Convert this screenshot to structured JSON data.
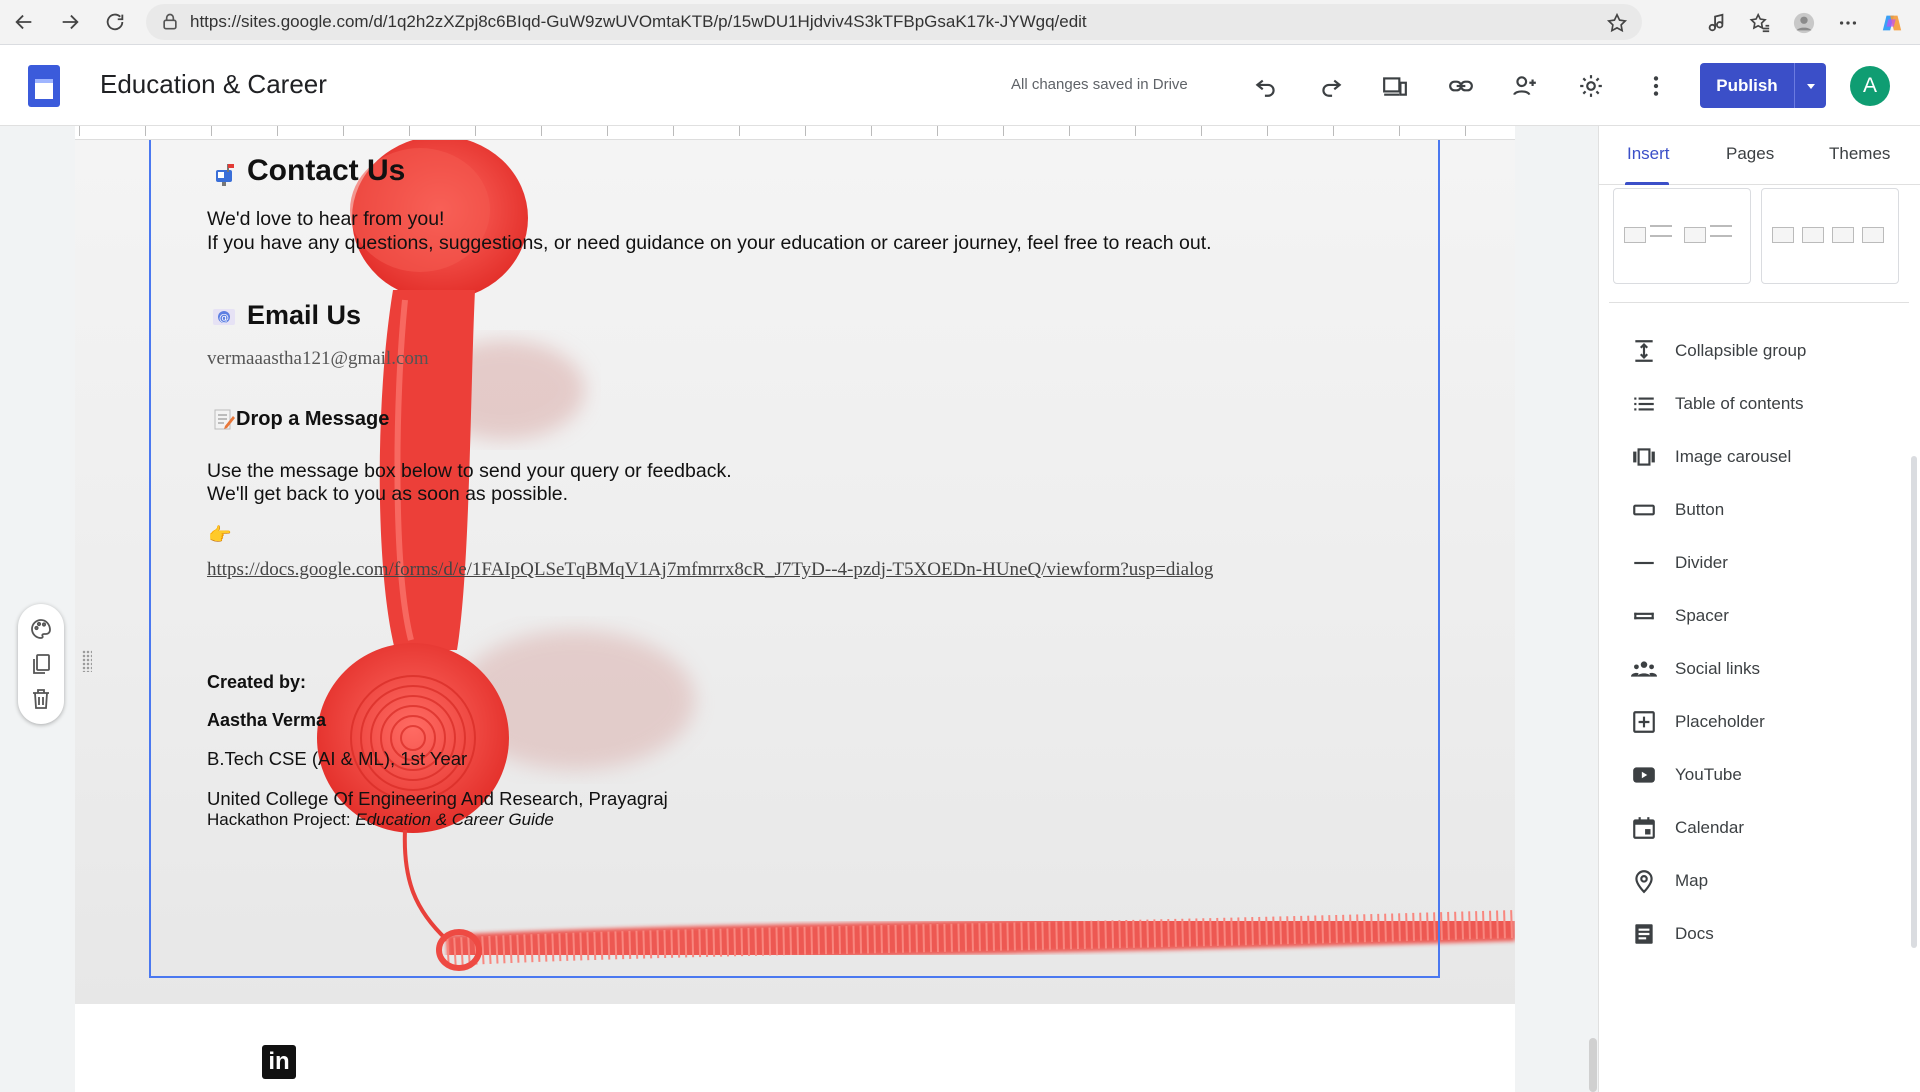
{
  "browser": {
    "url": "https://sites.google.com/d/1q2h2zXZpj8c6BIqd-GuW9zwUVOmtaKTB/p/15wDU1Hjdviv4S3kTFBpGsaK17k-JYWgq/edit"
  },
  "toolbar": {
    "site_title": "Education & Career",
    "saved_status": "All changes saved in Drive",
    "publish_label": "Publish",
    "avatar_letter": "A"
  },
  "content": {
    "contact_heading": "Contact Us",
    "contact_line1": "We'd love to hear from you!",
    "contact_line2": "If you have any questions, suggestions, or need guidance on your education or career journey, feel free to reach out.",
    "email_heading": "Email Us",
    "email_address": "vermaaastha121@gmail.com",
    "message_heading": "Drop a Message",
    "message_line1": "Use the message box below to send your query or feedback.",
    "message_line2": "We'll get back to you as soon as possible.",
    "pointer_emoji": "👉",
    "form_link": "https://docs.google.com/forms/d/e/1FAIpQLSeTqBMqV1Aj7mfmrrx8cR_J7TyD--4-pzdj-T5XOEDn-HUneQ/viewform?usp=dialog",
    "created_by_label": "Created by:",
    "author_name": "Aastha Verma",
    "author_course": "B.Tech CSE (AI & ML), 1st Year",
    "author_college": "United College Of Engineering And Research, Prayagraj",
    "project_prefix": "Hackathon Project: ",
    "project_name": "Education & Career Guide"
  },
  "footer": {
    "linkedin_glyph": "in"
  },
  "panel": {
    "tabs": [
      "Insert",
      "Pages",
      "Themes"
    ],
    "active_tab": "Insert",
    "items": [
      {
        "label": "Collapsible group",
        "icon": "collapsible-icon"
      },
      {
        "label": "Table of contents",
        "icon": "list-icon"
      },
      {
        "label": "Image carousel",
        "icon": "carousel-icon"
      },
      {
        "label": "Button",
        "icon": "button-icon"
      },
      {
        "label": "Divider",
        "icon": "divider-icon"
      },
      {
        "label": "Spacer",
        "icon": "spacer-icon"
      },
      {
        "label": "Social links",
        "icon": "people-icon"
      },
      {
        "label": "Placeholder",
        "icon": "add-box-icon"
      },
      {
        "label": "YouTube",
        "icon": "youtube-icon"
      },
      {
        "label": "Calendar",
        "icon": "calendar-icon"
      },
      {
        "label": "Map",
        "icon": "map-pin-icon"
      },
      {
        "label": "Docs",
        "icon": "docs-icon"
      }
    ]
  },
  "colors": {
    "accent": "#3b4fc8",
    "selection": "#4a78f0",
    "phone_red": "#f0443e"
  }
}
